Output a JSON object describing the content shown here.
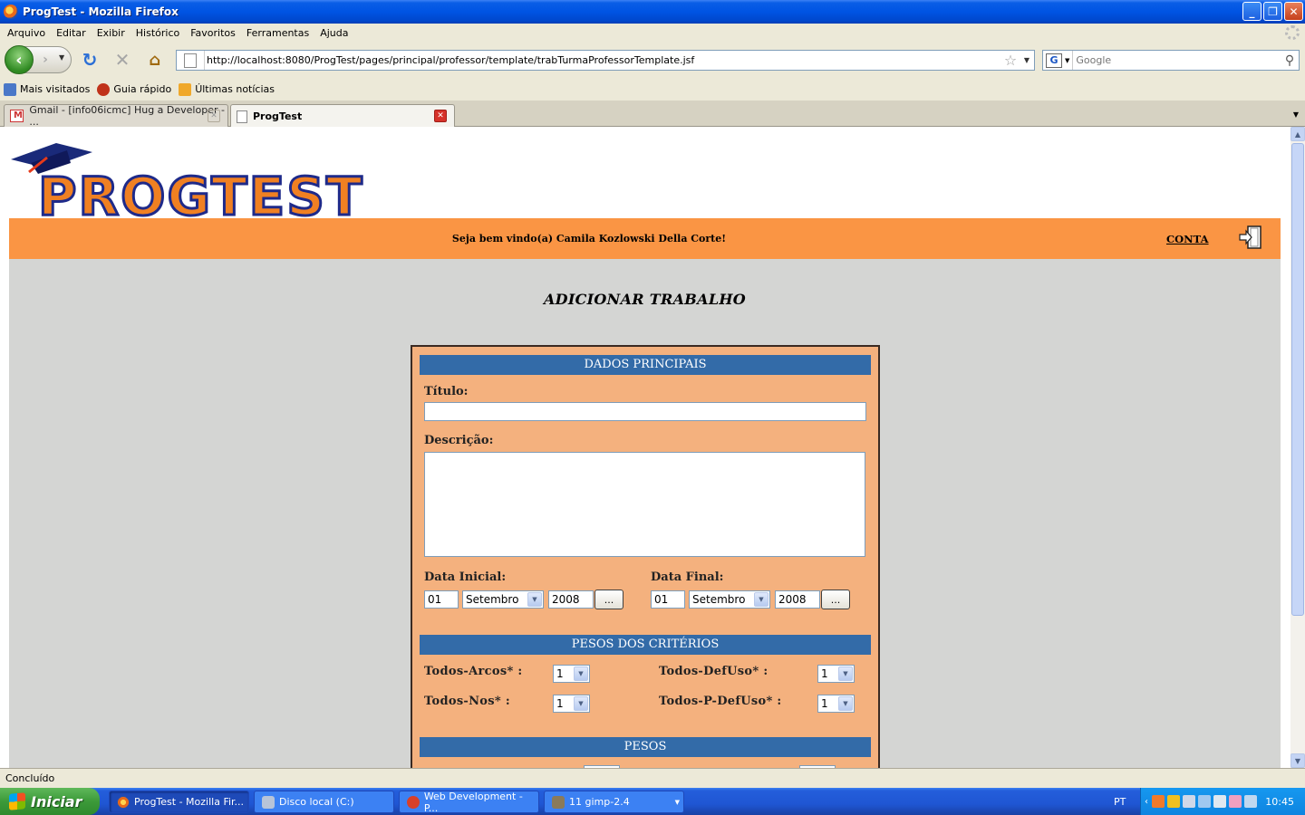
{
  "window": {
    "title": "ProgTest - Mozilla Firefox"
  },
  "menu": [
    "Arquivo",
    "Editar",
    "Exibir",
    "Histórico",
    "Favoritos",
    "Ferramentas",
    "Ajuda"
  ],
  "nav": {
    "url": "http://localhost:8080/ProgTest/pages/principal/professor/template/trabTurmaProfessorTemplate.jsf",
    "search_placeholder": "Google"
  },
  "bookmarks": [
    "Mais visitados",
    "Guia rápido",
    "Últimas notícias"
  ],
  "tabs": [
    {
      "label": "Gmail - [info06icmc] Hug a Developer - ..."
    },
    {
      "label": "ProgTest"
    }
  ],
  "page": {
    "logo_text": "PROGTEST",
    "welcome": "Seja bem vindo(a) Camila Kozlowski Della Corte!",
    "account_link": "CONTA",
    "title": "ADICIONAR TRABALHO",
    "sections": {
      "main": "DADOS PRINCIPAIS",
      "criteria": "PESOS DOS CRITÉRIOS",
      "weights": "PESOS"
    },
    "fields": {
      "titulo_label": "Título:",
      "titulo_value": "",
      "descricao_label": "Descrição:",
      "data_inicial_label": "Data Inicial:",
      "data_final_label": "Data Final:",
      "start_day": "01",
      "start_month": "Setembro",
      "start_year": "2008",
      "end_day": "01",
      "end_month": "Setembro",
      "end_year": "2008",
      "calendar_button": "..."
    },
    "criteria": {
      "todos_arcos": {
        "label": "Todos-Arcos* :",
        "value": "1"
      },
      "todos_defuso": {
        "label": "Todos-DefUso* :",
        "value": "1"
      },
      "todos_nos": {
        "label": "Todos-Nos* :",
        "value": "1"
      },
      "todos_pdefuso": {
        "label": "Todos-P-DefUso* :",
        "value": "1"
      }
    }
  },
  "status": "Concluído",
  "taskbar": {
    "start": "Iniciar",
    "tasks": [
      "ProgTest - Mozilla Fir...",
      "Disco local (C:)",
      "Web Development - P...",
      "11 gimp-2.4"
    ],
    "lang": "PT",
    "clock": "10:45"
  }
}
